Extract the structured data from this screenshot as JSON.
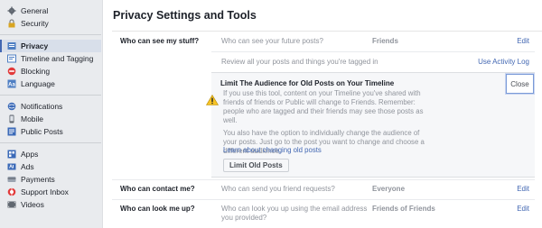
{
  "sidebar": {
    "groups": [
      [
        {
          "label": "General",
          "icon": "gear-icon"
        },
        {
          "label": "Security",
          "icon": "lock-icon"
        }
      ],
      [
        {
          "label": "Privacy",
          "icon": "privacy-lock-icon",
          "active": true
        },
        {
          "label": "Timeline and Tagging",
          "icon": "timeline-icon"
        },
        {
          "label": "Blocking",
          "icon": "blocking-icon"
        },
        {
          "label": "Language",
          "icon": "language-icon"
        }
      ],
      [
        {
          "label": "Notifications",
          "icon": "globe-icon"
        },
        {
          "label": "Mobile",
          "icon": "mobile-icon"
        },
        {
          "label": "Public Posts",
          "icon": "rss-icon"
        }
      ],
      [
        {
          "label": "Apps",
          "icon": "apps-icon"
        },
        {
          "label": "Ads",
          "icon": "ads-icon"
        },
        {
          "label": "Payments",
          "icon": "payments-icon"
        },
        {
          "label": "Support Inbox",
          "icon": "support-icon"
        },
        {
          "label": "Videos",
          "icon": "video-icon"
        }
      ]
    ]
  },
  "main": {
    "title": "Privacy Settings and Tools",
    "stuff": {
      "label": "Who can see my stuff?",
      "q1": "Who can see your future posts?",
      "q1_value": "Friends",
      "q1_edit": "Edit",
      "q2": "Review all your posts and things you're tagged in",
      "q2_link": "Use Activity Log"
    },
    "limit": {
      "title": "Limit The Audience for Old Posts on Your Timeline",
      "close": "Close",
      "para1": "If you use this tool, content on your Timeline you've shared with friends of friends or Public will change to Friends. Remember: people who are tagged and their friends may see those posts as well.",
      "para2": "You also have the option to individually change the audience of your posts. Just go to the post you want to change and choose a different audience.",
      "learn_link": "Learn about changing old posts",
      "button": "Limit Old Posts"
    },
    "contact": {
      "label": "Who can contact me?",
      "question": "Who can send you friend requests?",
      "value": "Everyone",
      "edit": "Edit"
    },
    "lookup": {
      "label": "Who can look me up?",
      "question": "Who can look you up using the email address you provided?",
      "value": "Friends of Friends",
      "edit": "Edit"
    }
  },
  "colors": {
    "link": "#4267b2",
    "muted": "#90949c",
    "warning": "#f7c325"
  }
}
